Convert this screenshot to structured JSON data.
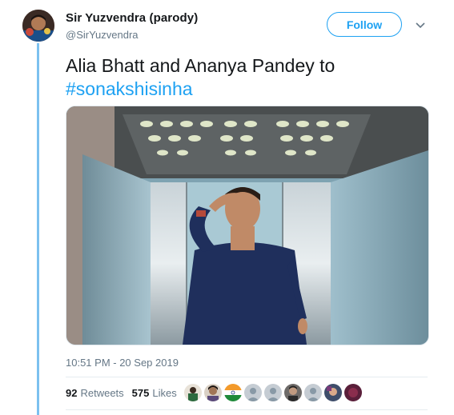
{
  "user": {
    "display_name": "Sir Yuzvendra (parody)",
    "handle": "@SirYuzvendra"
  },
  "follow_button": {
    "label": "Follow"
  },
  "more_menu": {
    "icon": "chevron-down-icon"
  },
  "tweet": {
    "text": "Alia Bhatt and Ananya Pandey to",
    "hashtag": "#sonakshisinha",
    "timestamp": "10:51 PM - 20 Sep 2019"
  },
  "stats": {
    "retweets_count": "92",
    "retweets_label": "Retweets",
    "likes_count": "575",
    "likes_label": "Likes"
  },
  "likers": [
    {
      "icon": "avatar-photo"
    },
    {
      "icon": "avatar-photo"
    },
    {
      "icon": "avatar-flag"
    },
    {
      "icon": "avatar-default"
    },
    {
      "icon": "avatar-default"
    },
    {
      "icon": "avatar-photo"
    },
    {
      "icon": "avatar-default"
    },
    {
      "icon": "avatar-photo"
    },
    {
      "icon": "avatar-photo"
    }
  ],
  "colors": {
    "accent": "#1da1f2",
    "thread_line": "#7cc1ef",
    "secondary_text": "#657786"
  }
}
